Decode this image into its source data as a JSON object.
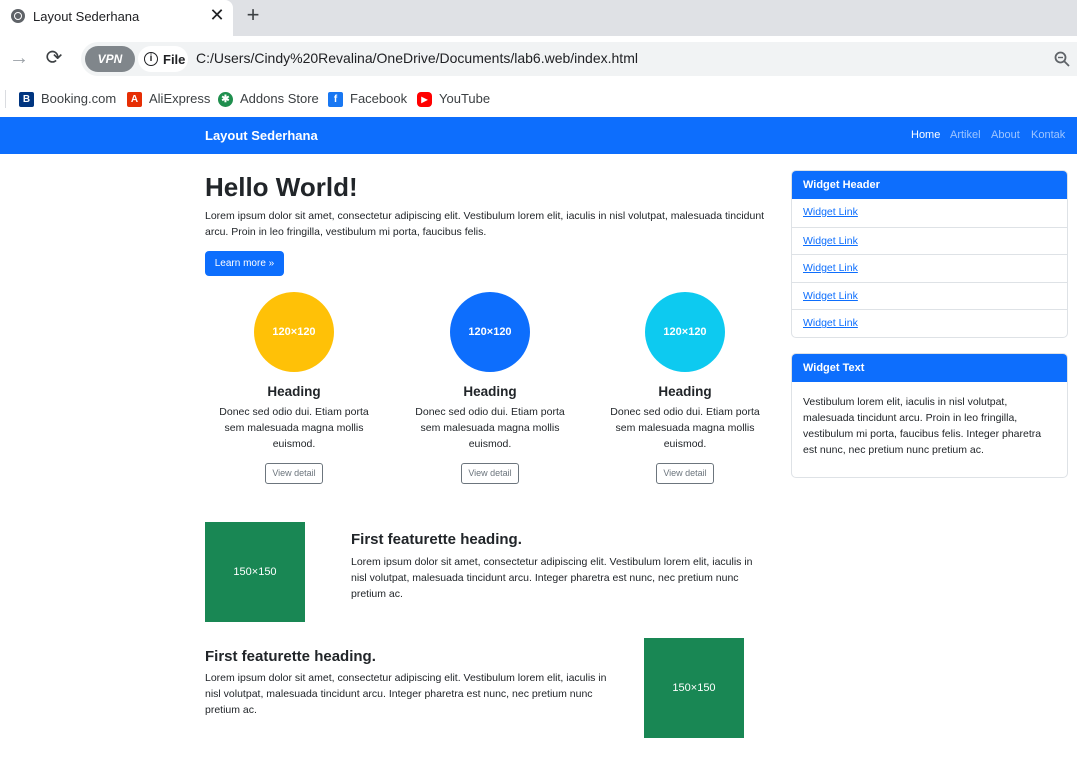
{
  "browser": {
    "tab_title": "Layout Sederhana",
    "close_glyph": "✕",
    "new_tab_glyph": "+",
    "forward_glyph": "→",
    "reload_glyph": "⟳",
    "vpn_label": "VPN",
    "file_label": "File",
    "info_glyph": "i",
    "url": "C:/Users/Cindy%20Revalina/OneDrive/Documents/lab6.web/index.html",
    "bookmarks": [
      {
        "label": "Booking.com",
        "icon": "B",
        "color": "#003580"
      },
      {
        "label": "AliExpress",
        "icon": "A",
        "color": "#e62e04"
      },
      {
        "label": "Addons Store",
        "icon": "✱",
        "color": "#1f8f4e"
      },
      {
        "label": "Facebook",
        "icon": "f",
        "color": "#1877f2"
      },
      {
        "label": "YouTube",
        "icon": "▶",
        "color": "#ff0000"
      }
    ]
  },
  "navbar": {
    "brand": "Layout Sederhana",
    "links": [
      "Home",
      "Artikel",
      "About",
      "Kontak"
    ]
  },
  "hero": {
    "title": "Hello World!",
    "text": "Lorem ipsum dolor sit amet, consectetur adipiscing elit. Vestibulum lorem elit, iaculis in nisl volutpat, malesuada tincidunt arcu. Proin in leo fringilla, vestibulum mi porta, faucibus felis.",
    "button": "Learn more »"
  },
  "columns": [
    {
      "placeholder": "120×120",
      "color": "#ffc107",
      "heading": "Heading",
      "text": "Donec sed odio dui. Etiam porta sem malesuada magna mollis euismod.",
      "button": "View detail"
    },
    {
      "placeholder": "120×120",
      "color": "#0d6efd",
      "heading": "Heading",
      "text": "Donec sed odio dui. Etiam porta sem malesuada magna mollis euismod.",
      "button": "View detail"
    },
    {
      "placeholder": "120×120",
      "color": "#0dcaf0",
      "heading": "Heading",
      "text": "Donec sed odio dui. Etiam porta sem malesuada magna mollis euismod.",
      "button": "View detail"
    }
  ],
  "featurettes": [
    {
      "image": "150×150",
      "heading": "First featurette heading.",
      "text": "Lorem ipsum dolor sit amet, consectetur adipiscing elit. Vestibulum lorem elit, iaculis in nisl volutpat, malesuada tincidunt arcu. Integer pharetra est nunc, nec pretium nunc pretium ac."
    },
    {
      "image": "150×150",
      "heading": "First featurette heading.",
      "text": "Lorem ipsum dolor sit amet, consectetur adipiscing elit. Vestibulum lorem elit, iaculis in nisl volutpat, malesuada tincidunt arcu. Integer pharetra est nunc, nec pretium nunc pretium ac."
    }
  ],
  "widget_links": {
    "header": "Widget Header",
    "links": [
      "Widget Link",
      "Widget Link",
      "Widget Link",
      "Widget Link",
      "Widget Link"
    ]
  },
  "widget_text": {
    "header": "Widget Text",
    "body": "Vestibulum lorem elit, iaculis in nisl volutpat, malesuada tincidunt arcu. Proin in leo fringilla, vestibulum mi porta, faucibus felis. Integer pharetra est nunc, nec pretium nunc pretium ac."
  },
  "colors": {
    "primary": "#0d6efd",
    "success": "#198754",
    "warning": "#ffc107",
    "info": "#0dcaf0"
  }
}
